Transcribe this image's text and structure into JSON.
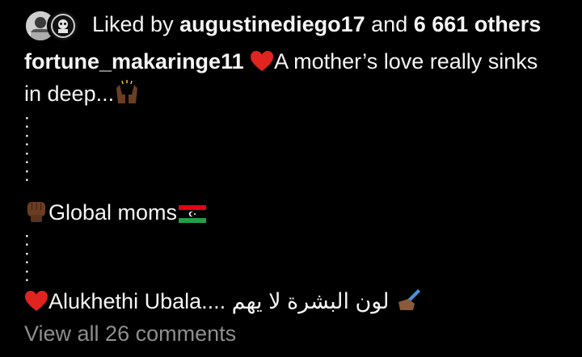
{
  "likes": {
    "prefix": "Liked by",
    "user": "augustinediego17",
    "connector": "and",
    "count": "6 661 others"
  },
  "post": {
    "username": "fortune_makaringe11",
    "caption_line1": "A mother’s love really sinks",
    "caption_line2": "in deep...",
    "dots": [
      ":",
      ":",
      ":",
      ":"
    ],
    "dots2": [
      ":",
      ":",
      ":"
    ],
    "line_global": "Global moms",
    "line_alukhethi": "Alukhethi Ubala.... لون البشرة لا يهم"
  },
  "comments": {
    "view_all": "View all 26 comments"
  },
  "icons": {
    "heart": "red-heart-icon",
    "raised_hands": "raised-hands-icon",
    "fist": "raised-fist-icon",
    "flag": "libya-flag-icon",
    "writing_hand": "writing-hand-icon"
  },
  "colors": {
    "background": "#000000",
    "text": "#f5f5f5",
    "muted": "#8e8e8e",
    "heart": "#e0241f"
  }
}
